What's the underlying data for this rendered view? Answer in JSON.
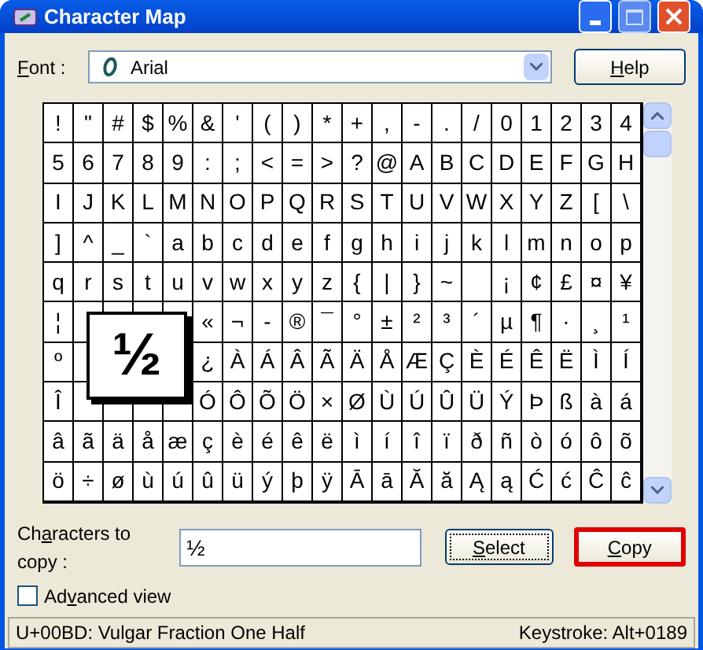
{
  "window": {
    "title": "Character Map"
  },
  "font": {
    "label": "Font :",
    "value": "Arial"
  },
  "help_button": "Help",
  "grid": {
    "rows": [
      [
        "!",
        "\"",
        "#",
        "$",
        "%",
        "&",
        "'",
        "(",
        ")",
        "*",
        "+",
        ",",
        "-",
        ".",
        "/",
        "0",
        "1",
        "2",
        "3",
        "4"
      ],
      [
        "5",
        "6",
        "7",
        "8",
        "9",
        ":",
        ";",
        "<",
        "=",
        ">",
        "?",
        "@",
        "A",
        "B",
        "C",
        "D",
        "E",
        "F",
        "G",
        "H"
      ],
      [
        "I",
        "J",
        "K",
        "L",
        "M",
        "N",
        "O",
        "P",
        "Q",
        "R",
        "S",
        "T",
        "U",
        "V",
        "W",
        "X",
        "Y",
        "Z",
        "[",
        "\\"
      ],
      [
        "]",
        "^",
        "_",
        "`",
        "a",
        "b",
        "c",
        "d",
        "e",
        "f",
        "g",
        "h",
        "i",
        "j",
        "k",
        "l",
        "m",
        "n",
        "o",
        "p"
      ],
      [
        "q",
        "r",
        "s",
        "t",
        "u",
        "v",
        "w",
        "x",
        "y",
        "z",
        "{",
        "|",
        "}",
        "~",
        null,
        "¡",
        "¢",
        "£",
        "¤",
        "¥"
      ],
      [
        "¦",
        null,
        null,
        null,
        null,
        "«",
        "¬",
        "-",
        "®",
        "¯",
        "°",
        "±",
        "²",
        "³",
        "´",
        "µ",
        "¶",
        "·",
        "¸",
        "¹"
      ],
      [
        "º",
        null,
        null,
        null,
        null,
        "¿",
        "À",
        "Á",
        "Â",
        "Ã",
        "Ä",
        "Å",
        "Æ",
        "Ç",
        "È",
        "É",
        "Ê",
        "Ë",
        "Ì",
        "Í"
      ],
      [
        "Î",
        null,
        null,
        null,
        null,
        "Ó",
        "Ô",
        "Õ",
        "Ö",
        "×",
        "Ø",
        "Ù",
        "Ú",
        "Û",
        "Ü",
        "Ý",
        "Þ",
        "ß",
        "à",
        "á"
      ],
      [
        "â",
        "ã",
        "ä",
        "å",
        "æ",
        "ç",
        "è",
        "é",
        "ê",
        "ë",
        "ì",
        "í",
        "î",
        "ï",
        "ð",
        "ñ",
        "ò",
        "ó",
        "ô",
        "õ"
      ],
      [
        "ö",
        "÷",
        "ø",
        "ù",
        "ú",
        "û",
        "ü",
        "ý",
        "þ",
        "ÿ",
        "Ā",
        "ā",
        "Ă",
        "ă",
        "Ą",
        "ą",
        "Ć",
        "ć",
        "Ĉ",
        "ĉ"
      ]
    ],
    "magnified": "½"
  },
  "copy": {
    "label": "Characters to copy :",
    "value": "½"
  },
  "select_button": "Select",
  "copy_button": {
    "label": "Copy",
    "highlighted": true
  },
  "advanced_view": {
    "label": "Advanced view",
    "checked": false
  },
  "status_bar": {
    "character": "U+00BD: Vulgar Fraction One Half",
    "keystroke": "Keystroke: Alt+0189"
  }
}
